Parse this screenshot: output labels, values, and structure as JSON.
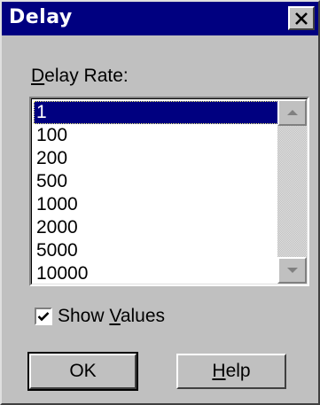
{
  "window": {
    "title": "Delay",
    "close_icon": "close-icon"
  },
  "delay_rate": {
    "label_underlined": "D",
    "label_rest": "elay Rate:",
    "items": [
      "1",
      "100",
      "200",
      "500",
      "1000",
      "2000",
      "5000",
      "10000"
    ],
    "selected_index": 0
  },
  "show_values": {
    "label_before": "Show ",
    "label_underlined": "V",
    "label_after": "alues",
    "checked": true
  },
  "buttons": {
    "ok_label": "OK",
    "help_underlined": "H",
    "help_rest": "elp"
  },
  "colors": {
    "titlebar": "#000080",
    "face": "#c0c0c0",
    "selection": "#000080"
  }
}
